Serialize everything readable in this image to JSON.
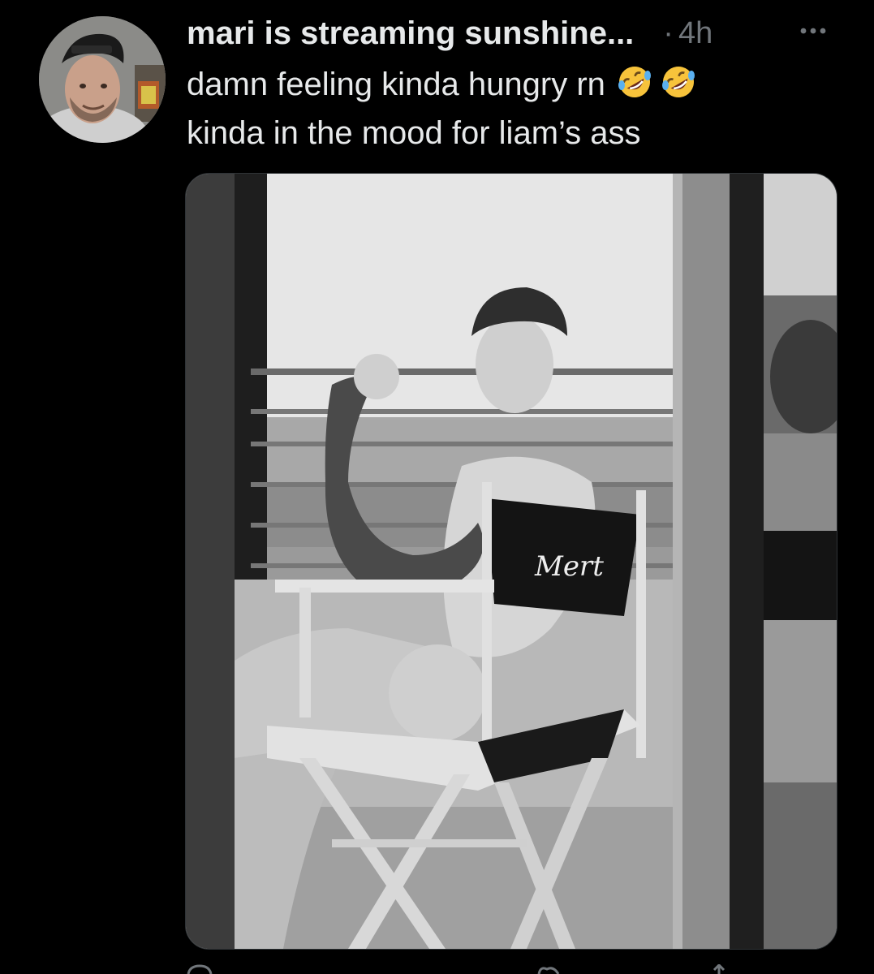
{
  "tweet": {
    "author": {
      "display_name": "mari is streaming sunshine..."
    },
    "separator": "·",
    "timestamp": "4h",
    "text_lines": [
      "damn feeling kinda hungry rn",
      "kinda in the mood for liam’s ass"
    ],
    "emojis": [
      "rolling-on-floor-laughing",
      "rolling-on-floor-laughing"
    ],
    "media": {
      "chair_text": "Mert"
    }
  },
  "colors": {
    "background": "#000000",
    "primary_text": "#e7e9ea",
    "secondary_text": "#71767b"
  }
}
